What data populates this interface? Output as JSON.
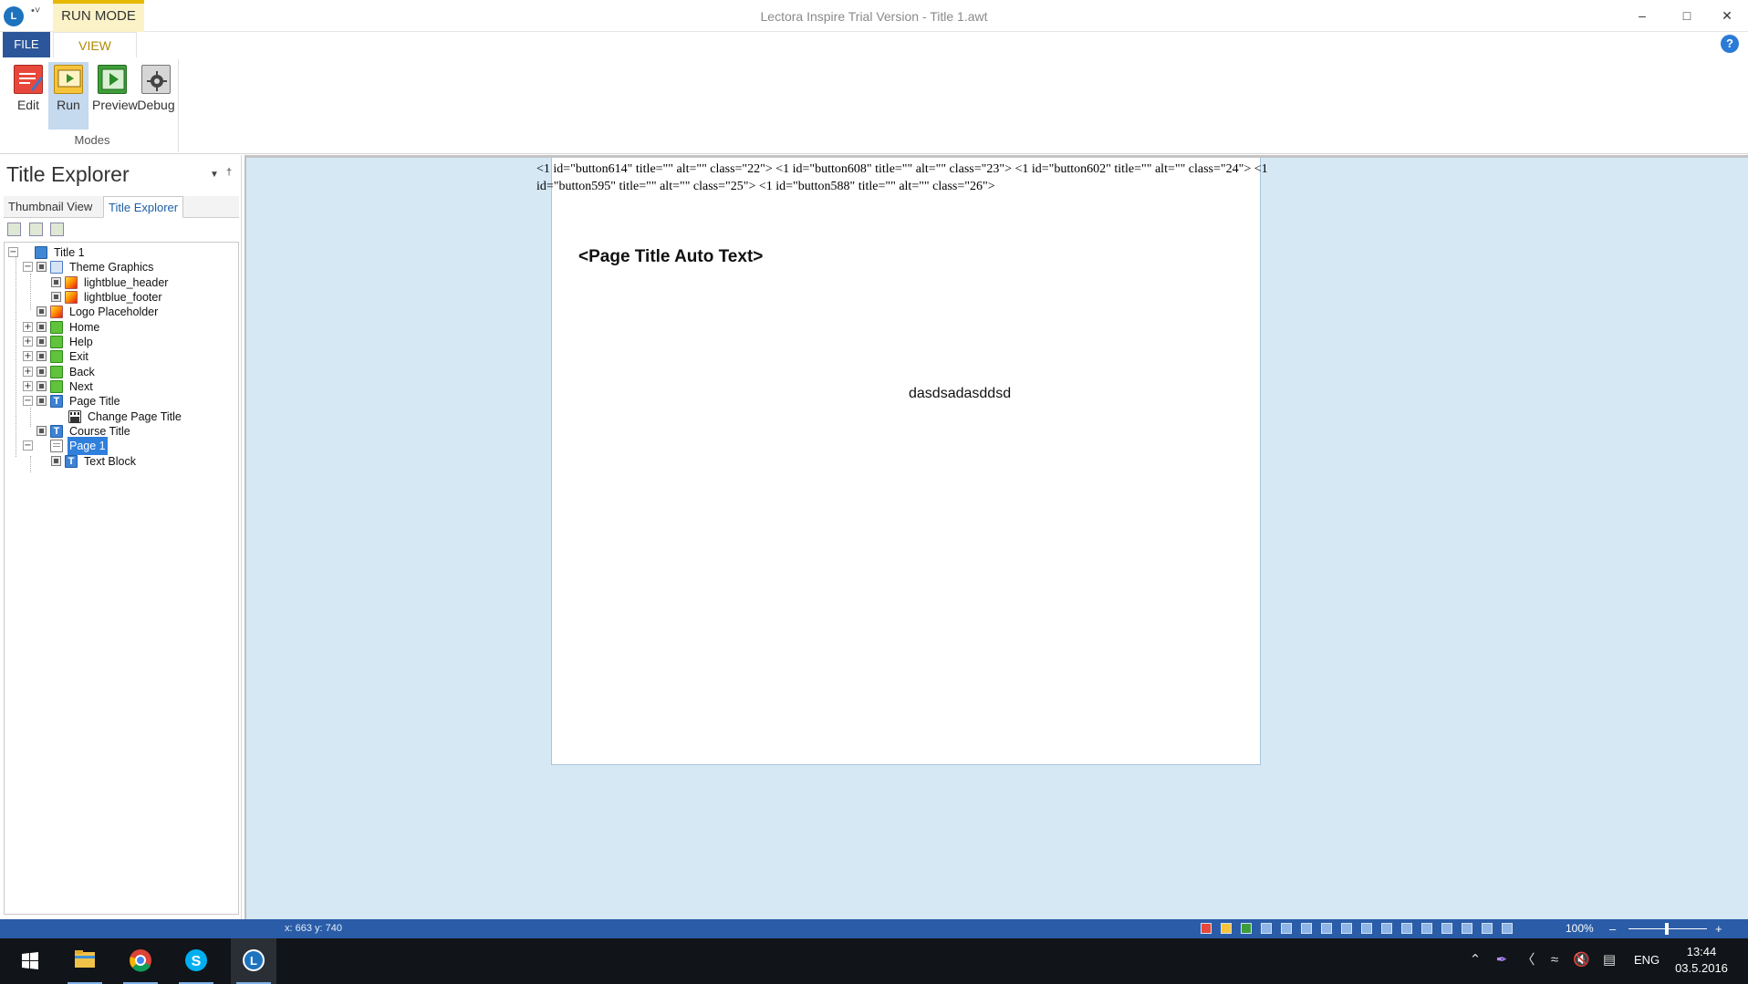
{
  "titlebar": {
    "run_mode_label": "RUN MODE",
    "window_title": "Lectora Inspire Trial Version - Title 1.awt",
    "quick_access": "•˅",
    "minimize": "–",
    "maximize": "□",
    "close": "✕"
  },
  "ribbon": {
    "file_tab": "FILE",
    "view_tab": "VIEW",
    "help_glyph": "?",
    "modes": [
      {
        "label": "Edit",
        "icon": "edit-mode-icon"
      },
      {
        "label": "Run",
        "icon": "run-mode-icon"
      },
      {
        "label": "Preview",
        "icon": "preview-mode-icon"
      },
      {
        "label": "Debug",
        "icon": "debug-mode-icon"
      }
    ],
    "group_label": "Modes"
  },
  "left_panel": {
    "title": "Title Explorer",
    "tabs": [
      "Thumbnail View",
      "Title Explorer"
    ],
    "active_tab": "Title Explorer",
    "tree": [
      {
        "label": "Title 1",
        "icon": "title-icon"
      },
      {
        "label": "Theme Graphics",
        "icon": "theme-icon"
      },
      {
        "label": "lightblue_header",
        "icon": "image-icon"
      },
      {
        "label": "lightblue_footer",
        "icon": "image-icon"
      },
      {
        "label": "Logo Placeholder",
        "icon": "image-icon"
      },
      {
        "label": "Home",
        "icon": "button-icon"
      },
      {
        "label": "Help",
        "icon": "button-icon"
      },
      {
        "label": "Exit",
        "icon": "button-icon"
      },
      {
        "label": "Back",
        "icon": "button-icon"
      },
      {
        "label": "Next",
        "icon": "button-icon"
      },
      {
        "label": "Page Title",
        "icon": "text-icon"
      },
      {
        "label": "Change Page Title",
        "icon": "action-icon"
      },
      {
        "label": "Course Title",
        "icon": "text-icon"
      },
      {
        "label": "Page 1",
        "icon": "page-icon"
      },
      {
        "label": "Text Block",
        "icon": "text-icon"
      }
    ],
    "selected_item": "Page 1"
  },
  "canvas": {
    "raw_markup": "<1 id=\"button614\" title=\"\" alt=\"\" class=\"22\"> <1 id=\"button608\" title=\"\" alt=\"\" class=\"23\"> <1 id=\"button602\" title=\"\" alt=\"\" class=\"24\"> <1 id=\"button595\" title=\"\" alt=\"\" class=\"25\"> <1 id=\"button588\" title=\"\" alt=\"\" class=\"26\">",
    "page_title_auto": "<Page Title Auto Text>",
    "text_block": "dasdsadasddsd"
  },
  "statusbar": {
    "coords": "x: 663  y: 740",
    "zoom": "100%",
    "zoom_minus": "–",
    "zoom_plus": "+"
  },
  "taskbar": {
    "apps": [
      "file-explorer-icon",
      "chrome-icon",
      "skype-icon",
      "lectora-icon"
    ],
    "language": "ENG",
    "time": "13:44",
    "date": "03.5.2016"
  },
  "colors": {
    "ribbon_file": "#2b579a",
    "run_mode_accent": "#e6b800",
    "canvas_bg": "#d6e8f4",
    "statusbar": "#2a5ca8",
    "selection": "#2f7fdc",
    "taskbar": "#111418"
  }
}
